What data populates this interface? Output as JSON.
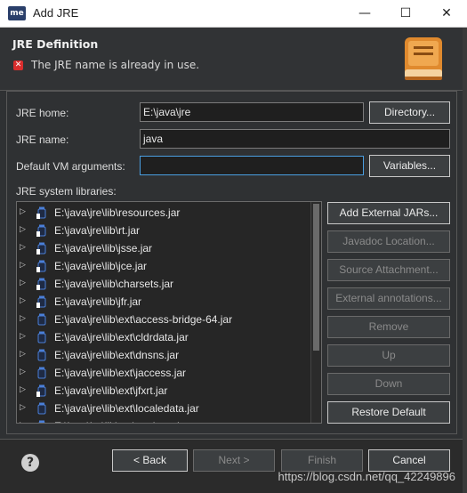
{
  "window": {
    "app_icon_text": "me",
    "title": "Add JRE",
    "minimize_glyph": "—",
    "maximize_glyph": "☐",
    "close_glyph": "✕"
  },
  "header": {
    "title": "JRE Definition",
    "error_message": "The JRE name is already in use.",
    "error_glyph": "✕",
    "icon": "book-icon",
    "icon_color": "#e08a2e"
  },
  "form": {
    "jre_home_label": "JRE home:",
    "jre_home_value": "E:\\java\\jre",
    "directory_button": "Directory...",
    "jre_name_label": "JRE name:",
    "jre_name_value": "java",
    "vm_args_label": "Default VM arguments:",
    "vm_args_value": "",
    "variables_button": "Variables...",
    "libraries_label": "JRE system libraries:"
  },
  "libraries": [
    {
      "path": "E:\\java\\jre\\lib\\resources.jar",
      "expandable": true,
      "icon": "jar-source-icon"
    },
    {
      "path": "E:\\java\\jre\\lib\\rt.jar",
      "expandable": true,
      "icon": "jar-source-icon"
    },
    {
      "path": "E:\\java\\jre\\lib\\jsse.jar",
      "expandable": true,
      "icon": "jar-source-icon"
    },
    {
      "path": "E:\\java\\jre\\lib\\jce.jar",
      "expandable": true,
      "icon": "jar-source-icon"
    },
    {
      "path": "E:\\java\\jre\\lib\\charsets.jar",
      "expandable": true,
      "icon": "jar-source-icon"
    },
    {
      "path": "E:\\java\\jre\\lib\\jfr.jar",
      "expandable": true,
      "icon": "jar-source-icon"
    },
    {
      "path": "E:\\java\\jre\\lib\\ext\\access-bridge-64.jar",
      "expandable": true,
      "icon": "jar-icon"
    },
    {
      "path": "E:\\java\\jre\\lib\\ext\\cldrdata.jar",
      "expandable": true,
      "icon": "jar-icon"
    },
    {
      "path": "E:\\java\\jre\\lib\\ext\\dnsns.jar",
      "expandable": true,
      "icon": "jar-icon"
    },
    {
      "path": "E:\\java\\jre\\lib\\ext\\jaccess.jar",
      "expandable": true,
      "icon": "jar-icon"
    },
    {
      "path": "E:\\java\\jre\\lib\\ext\\jfxrt.jar",
      "expandable": true,
      "icon": "jar-source-icon"
    },
    {
      "path": "E:\\java\\jre\\lib\\ext\\localedata.jar",
      "expandable": true,
      "icon": "jar-icon"
    },
    {
      "path": "E:\\java\\jre\\lib\\ext\\nashorn.jar",
      "expandable": true,
      "icon": "jar-icon"
    }
  ],
  "side_buttons": {
    "add_external": "Add External JARs...",
    "javadoc": "Javadoc Location...",
    "source": "Source Attachment...",
    "annotations": "External annotations...",
    "remove": "Remove",
    "up": "Up",
    "down": "Down",
    "restore": "Restore Default"
  },
  "footer": {
    "help_glyph": "?",
    "back": "< Back",
    "next": "Next >",
    "finish": "Finish",
    "cancel": "Cancel",
    "watermark": "https://blog.csdn.net/qq_42249896"
  },
  "colors": {
    "accent_focus": "#4a9ee0",
    "error": "#d92d2d",
    "jar_icon": "#4a7fd8"
  }
}
